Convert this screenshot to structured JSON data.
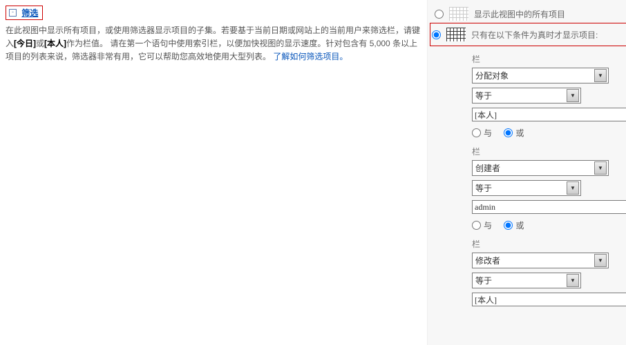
{
  "header": {
    "toggle": "-",
    "title": "筛选"
  },
  "desc": {
    "t1": "在此视图中显示所有项目，或使用筛选器显示项目的子集。若要基于当前日期或网站上的当前用户来筛选栏，请键入",
    "b1": "[今日]",
    "t2": "或",
    "b2": "[本人]",
    "t3": "作为栏值。 请在第一个语句中使用索引栏，以便加快视图的显示速度。针对包含有 5,000 条以上项目的列表来说，筛选器非常有用，它可以帮助您高效地使用大型列表。",
    "link": "了解如何筛选项目。"
  },
  "opt": {
    "all": "显示此视图中的所有项目",
    "cond": "只有在以下条件为真时才显示项目:"
  },
  "lbl": {
    "col": "栏",
    "and": "与",
    "or": "或"
  },
  "f1": {
    "col": "分配对象",
    "op": "等于",
    "val": "[本人]"
  },
  "f2": {
    "col": "创建者",
    "op": "等于",
    "val": "admin"
  },
  "f3": {
    "col": "修改者",
    "op": "等于",
    "val": "[本人]"
  }
}
